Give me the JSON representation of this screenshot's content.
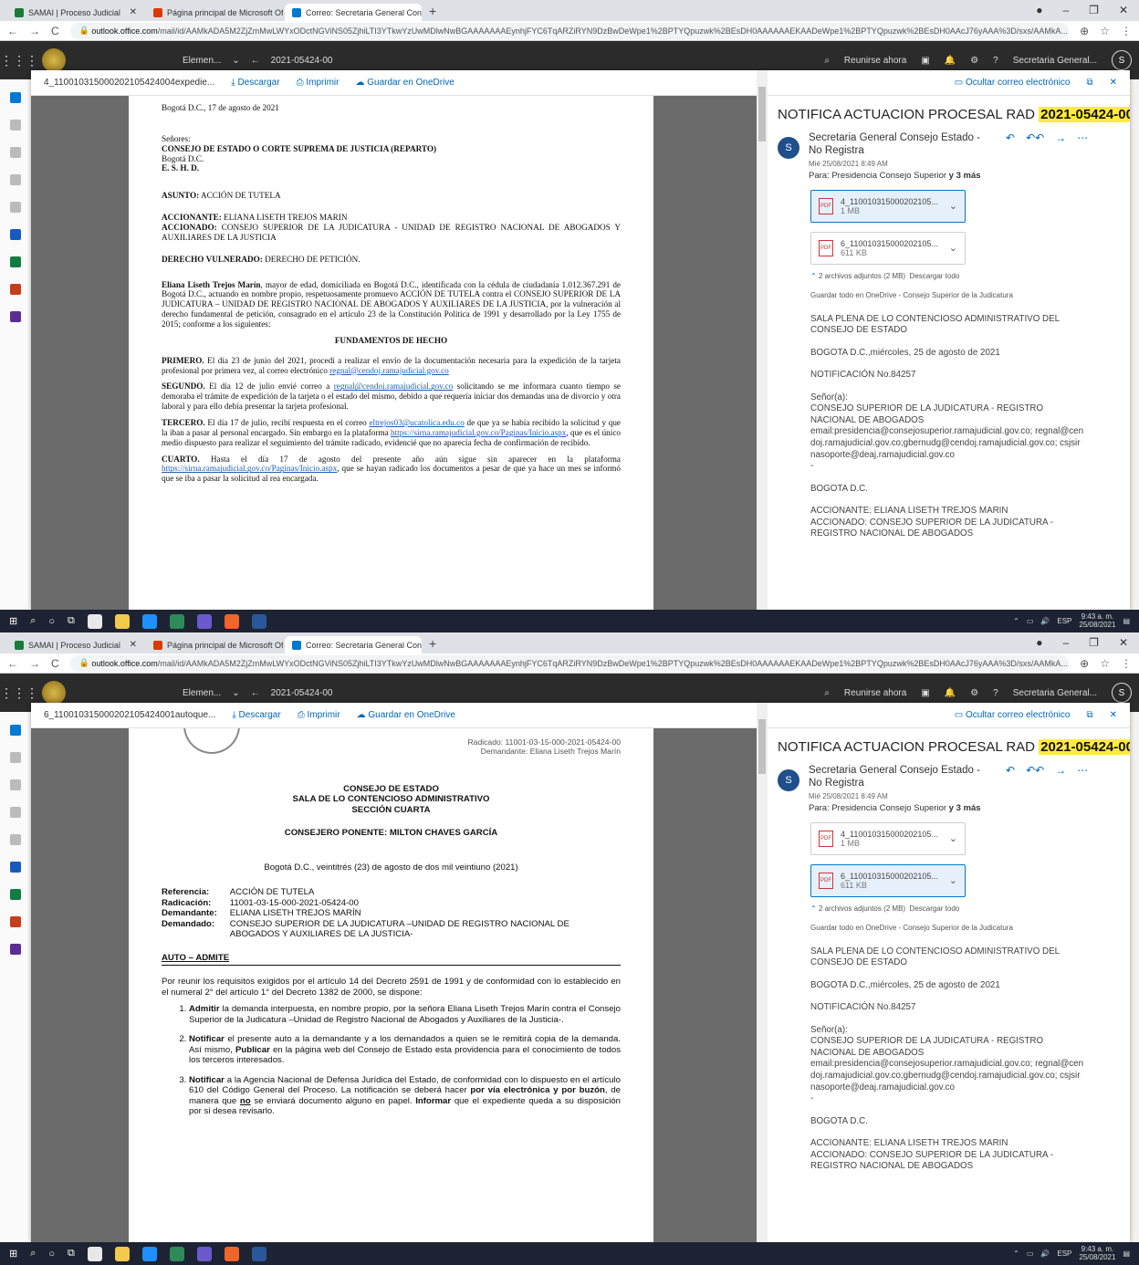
{
  "browser": {
    "tabs": [
      {
        "label": "SAMAI | Proceso Judicial",
        "color": "#1b7b3a"
      },
      {
        "label": "Página principal de Microsoft Of",
        "color": "#d83b01"
      },
      {
        "label": "Correo: Secretaria General Conse",
        "color": "#0078d4"
      }
    ],
    "url_host": "outlook.office.com",
    "url_paths": [
      "/mail/id/AAMkADA5M2ZjZmMwLWYxODctNGViNS05ZjhiLTI3YTkwYzUwMDlwNwBGAAAAAAAEynhjFYC6TqARZiRYN9DzBwDeWpe1%2BPTYQpuzwk%2BEsDH0AAAAAAEKAADeWpe1%2BPTYQpuzwk%2BEsDH0AAcJ76yAAA%3D/sxs/AAMkA...",
      "/mail/id/AAMkADA5M2ZjZmMwLWYxODctNGViNS05ZjhiLTI3YTkwYzUwMDlwNwBGAAAAAAAEynhjFYC6TqARZiRYN9DzBwDeWpe1%2BPTYQpuzwk%2BEsDH0AAAAAAEKAADeWpe1%2BPTYQpuzwk%2BEsDH0AAcJ76yAAA%3D/sxs/AAMkA..."
    ]
  },
  "owa": {
    "folder_dropdown": "Elemen...",
    "conversation_id": "2021-05424-00",
    "meet_now": "Reunirse ahora",
    "account": "Secretaria General...",
    "avatar_letter": "S"
  },
  "viewers": [
    {
      "attachment_name": "4_110010315000202105424004expedie...",
      "download": "Descargar",
      "print": "Imprimir",
      "save": "Guardar en OneDrive",
      "hide_email": "Ocultar correo electrónico"
    },
    {
      "attachment_name": "6_110010315000202105424001autoque...",
      "download": "Descargar",
      "print": "Imprimir",
      "save": "Guardar en OneDrive",
      "hide_email": "Ocultar correo electrónico"
    }
  ],
  "doc1": {
    "date": "Bogotá D.C., 17 de agosto de 2021",
    "greeting": "Señores:",
    "addressee": "CONSEJO DE ESTADO O CORTE SUPREMA DE JUSTICIA (REPARTO)",
    "city": "Bogotá D.C.",
    "ehd": "E.       S.       H.       D.",
    "asunto_label": "ASUNTO:",
    "asunto": "ACCIÓN DE TUTELA",
    "accionante_label": "ACCIONANTE:",
    "accionante": "ELIANA LISETH TREJOS MARIN",
    "accionado_label": "ACCIONADO:",
    "accionado": "CONSEJO SUPERIOR DE LA JUDICATURA - UNIDAD DE REGISTRO NACIONAL DE ABOGADOS Y AUXILIARES DE LA JUSTICIA",
    "derecho_label": "DERECHO VULNERADO:",
    "derecho": "DERECHO DE PETICIÓN.",
    "intro_name": "Eliana Liseth Trejos Marín",
    "intro": ", mayor de edad, domiciliada en Bogotá D.C., identificada con la cédula de ciudadanía 1.012.367.291 de Bogotá D.C., actuando en nombre propio, respetuosamente promuevo ACCIÓN DE TUTELA contra el CONSEJO SUPERIOR DE LA JUDICATURA – UNIDAD DE REGISTRO NACIONAL DE ABOGADOS Y AUXILIARES DE LA JUSTICIA, por la vulneración al derecho fundamental de petición, consagrado en el artículo 23 de la Constitución Política de 1991 y desarrollado por la Ley 1755 de 2015; conforme a los siguientes:",
    "heading": "FUNDAMENTOS DE HECHO",
    "primero_label": "PRIMERO.",
    "primero": " El día 23 de junio del 2021, procedí a realizar el envío de la documentación necesaria para la expedición de la tarjeta profesional por primera vez, al correo electrónico ",
    "primero_link": "regnal@cendoj.ramajudicial.gov.co",
    "segundo_label": "SEGUNDO.",
    "segundo_a": " El día 12 de julio envié correo a ",
    "segundo_link": "regnal@cendoj.ramajudicial.gov.co",
    "segundo_b": " solicitando se me informara cuanto tiempo se demoraba el trámite de expedición de la tarjeta o el estado del mismo, debido a que requería iniciar dos demandas una de divorcio y otra laboral y para ello debía presentar la tarjeta profesional.",
    "tercero_label": "TERCERO.",
    "tercero_a": " El día 17 de julio, recibí respuesta en el correo ",
    "tercero_link1": "eltrejos03@ucatolica.edu.co",
    "tercero_b": " de que ya se había recibido la solicitud y que la iban a pasar al personal encargado. Sin embargo en la plataforma ",
    "tercero_link2": "https://sirna.ramajudicial.gov.co/Paginas/Inicio.aspx",
    "tercero_c": ", que es el único medio dispuesto para realizar el seguimiento del trámite radicado, evidencié que no aparecía fecha de confirmación de recibido.",
    "cuarto_label": "CUARTO.",
    "cuarto_a": " Hasta el día 17 de agosto del presente año aún sigue sin aparecer en la plataforma ",
    "cuarto_link": "https://sirna.ramajudicial.gov.co/Paginas/Inicio.aspx",
    "cuarto_b": ", que se hayan radicado los documentos a pesar de que ya hace un mes se informó que se iba a pasar la solicitud al rea encargada."
  },
  "doc2": {
    "radicado": "Radicado: 11001-03-15-000-2021-05424-00",
    "demandante_hdr": "Demandante: Eliana Liseth Trejos Marín",
    "title1": "CONSEJO DE ESTADO",
    "title2": "SALA DE LO CONTENCIOSO ADMINISTRATIVO",
    "title3": "SECCIÓN CUARTA",
    "ponente": "CONSEJERO PONENTE: MILTON CHAVES GARCÍA",
    "date": "Bogotá D.C., veintitrés (23) de agosto de dos mil veintiuno (2021)",
    "ref_rows": [
      {
        "label": "Referencia:",
        "value": "ACCIÓN DE TUTELA"
      },
      {
        "label": "Radicación:",
        "value": "11001-03-15-000-2021-05424-00"
      },
      {
        "label": "Demandante:",
        "value": "ELIANA LISETH TREJOS MARÍN"
      },
      {
        "label": "Demandado:",
        "value": "CONSEJO SUPERIOR DE LA JUDICATURA –UNIDAD DE REGISTRO NACIONAL DE ABOGADOS Y AUXILIARES DE LA JUSTICIA-"
      }
    ],
    "auto": "AUTO – ADMITE",
    "intro": "Por reunir los requisitos exigidos por el artículo 14 del Decreto 2591 de 1991 y de conformidad con lo establecido en el numeral 2° del artículo 1° del Decreto 1382 de 2000, se dispone:",
    "item1_b": "Admitir",
    "item1": " la demanda interpuesta, en nombre propio, por la señora Eliana Liseth Trejos Marín contra el Consejo Superior de la Judicatura –Unidad de Registro Nacional de Abogados y Auxiliares de la Justicia-.",
    "item2_b": "Notificar",
    "item2_a": " el presente auto a la demandante y a los demandados a quien se le remitirá copia de la demanda. Así mismo, ",
    "item2_b2": "Publicar",
    "item2_c": " en la página web del Consejo de Estado esta providencia para el conocimiento de todos los terceros interesados.",
    "item3_b": "Notificar",
    "item3_a": " a la Agencia Nacional de Defensa Jurídica del Estado, de conformidad con lo dispuesto en el artículo 610 del Código General del Proceso. La notificación se deberá hacer ",
    "item3_b2": "por vía electrónica y por buzón",
    "item3_c": ", de manera que ",
    "item3_no": "no",
    "item3_d": " se enviará documento alguno en papel. ",
    "item3_b3": "Informar",
    "item3_e": " que el expediente queda a su disposición por si desea revisarlo."
  },
  "email": {
    "subject_prefix": "NOTIFICA ACTUACION PROCESAL RAD ",
    "subject_rad": "2021-05424-00",
    "sender": "Secretaria General Consejo Estado - No Registra",
    "sender_initial": "S",
    "date": "Mié 25/08/2021 8:49 AM",
    "to_prefix": "Para:  Presidencia Consejo Superior ",
    "to_more": "y 3 más",
    "attachments": [
      {
        "name": "4_110010315000202105...",
        "size": "1 MB",
        "icon": "PDF"
      },
      {
        "name": "6_110010315000202105...",
        "size": "611 KB",
        "icon": "PDF"
      }
    ],
    "att_summary": "2 archivos adjuntos (2 MB)",
    "download_all": "Descargar todo",
    "save_all": "Guardar todo en OneDrive - Consejo Superior de la Judicatura",
    "body_p1": "SALA PLENA DE LO CONTENCIOSO ADMINISTRATIVO DEL CONSEJO DE ESTADO",
    "body_p2": "BOGOTA D.C.,miércoles, 25 de agosto de 2021",
    "body_p3": "NOTIFICACIÓN No.84257",
    "body_p4a": "Señor(a):",
    "body_p4b": "CONSEJO SUPERIOR DE LA JUDICATURA - REGISTRO NACIONAL DE ABOGADOS",
    "body_p4c": "email:presidencia@consejosuperior.ramajudicial.gov.co; regnal@cendoj.ramajudicial.gov.co;gbernudg@cendoj.ramajudicial.gov.co; csjsirnasoporte@deaj.ramajudicial.gov.co",
    "body_dash": "-",
    "body_p5": "BOGOTA D.C.",
    "body_p6a": "ACCIONANTE: ELIANA LISETH TREJOS MARIN",
    "body_p6b": "ACCIONADO: CONSEJO SUPERIOR DE LA JUDICATURA - REGISTRO NACIONAL DE ABOGADOS"
  },
  "taskbar": {
    "time": "9:43 a. m.",
    "date": "25/08/2021",
    "lang": "ESP"
  }
}
